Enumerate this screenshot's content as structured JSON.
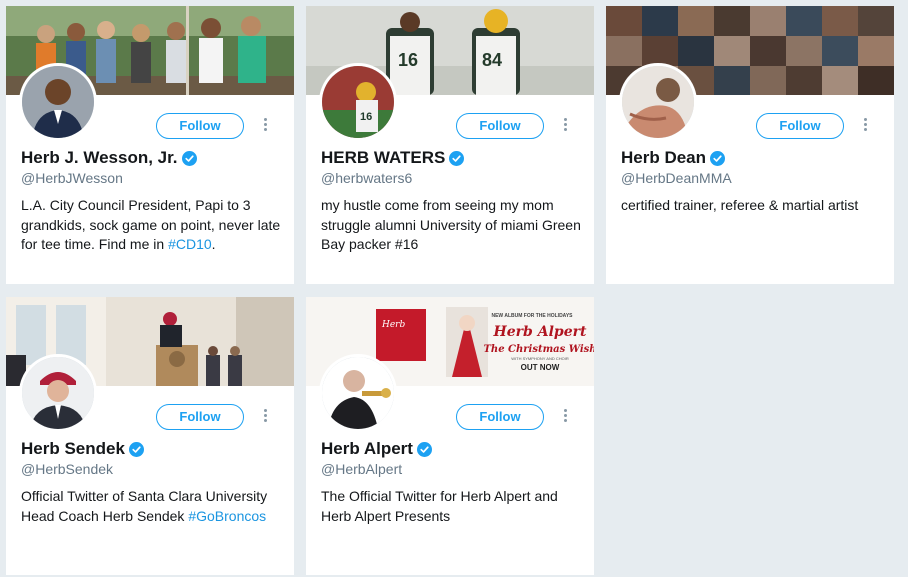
{
  "colors": {
    "background": "#e6ecf0",
    "accent": "#1da1f2",
    "link": "#1b95e0",
    "verified": "#1da1f2",
    "name_text": "#14171a",
    "handle_text": "#657786"
  },
  "cards": [
    {
      "name": "Herb J. Wesson, Jr.",
      "verified": true,
      "handle": "@HerbJWesson",
      "bio_text": "L.A. City Council President, Papi to 3 grandkids, sock game on point, never late for tee time. Find me in ",
      "bio_link": "#CD10",
      "bio_after": ".",
      "follow_label": "Follow",
      "banner_desc": "group-photo-banner",
      "avatar_desc": "profile-photo"
    },
    {
      "name": "HERB WATERS",
      "verified": true,
      "handle": "@herbwaters6",
      "bio_text": "my hustle come from seeing my mom struggle alumni University of miami Green Bay packer #16",
      "bio_link": "",
      "bio_after": "",
      "follow_label": "Follow",
      "banner_desc": "football-players-banner",
      "avatar_desc": "profile-photo"
    },
    {
      "name": "Herb Dean",
      "verified": true,
      "handle": "@HerbDeanMMA",
      "bio_text": "certified trainer, referee & martial artist",
      "bio_link": "",
      "bio_after": "",
      "follow_label": "Follow",
      "banner_desc": "photo-collage-banner",
      "avatar_desc": "profile-photo"
    },
    {
      "name": "Herb Sendek",
      "verified": true,
      "handle": "@HerbSendek",
      "bio_text": "Official Twitter of Santa Clara University Head Coach Herb Sendek ",
      "bio_link": "#GoBroncos",
      "bio_after": "",
      "follow_label": "Follow",
      "banner_desc": "podium-speech-banner",
      "avatar_desc": "profile-photo"
    },
    {
      "name": "Herb Alpert",
      "verified": true,
      "handle": "@HerbAlpert",
      "bio_text": "The Official Twitter for Herb Alpert and Herb Alpert Presents",
      "bio_link": "",
      "bio_after": "",
      "follow_label": "Follow",
      "banner_desc": "album-promo-banner",
      "banner_text": {
        "kicker": "NEW ALBUM FOR THE HOLIDAYS",
        "artist": "Herb Alpert",
        "title": "The Christmas Wish",
        "sub": "WITH SYMPHONY AND CHOIR",
        "cta": "OUT NOW"
      },
      "avatar_desc": "profile-photo"
    }
  ]
}
